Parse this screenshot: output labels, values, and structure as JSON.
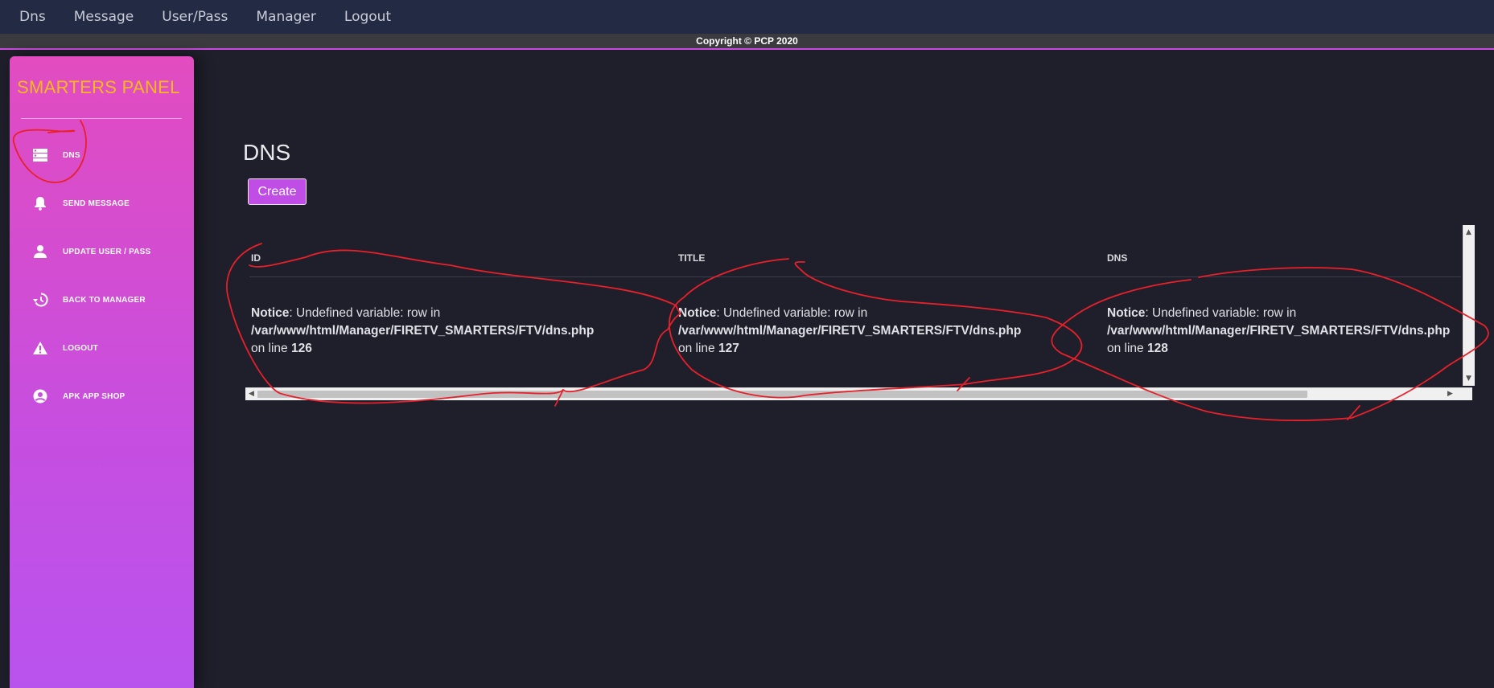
{
  "topnav": {
    "items": [
      "Dns",
      "Message",
      "User/Pass",
      "Manager",
      "Logout"
    ]
  },
  "copyright": "Copyright © PCP 2020",
  "sidebar": {
    "brand": "SMARTERS PANEL",
    "items": [
      {
        "label": "DNS",
        "icon": "dns-server-icon"
      },
      {
        "label": "SEND MESSAGE",
        "icon": "bell-icon"
      },
      {
        "label": "UPDATE USER / PASS",
        "icon": "person-icon"
      },
      {
        "label": "BACK TO MANAGER",
        "icon": "history-icon"
      },
      {
        "label": "LOGOUT",
        "icon": "warning-icon"
      },
      {
        "label": "APK APP SHOP",
        "icon": "account-circle-icon"
      }
    ]
  },
  "main": {
    "title": "DNS",
    "create_label": "Create",
    "table": {
      "columns": [
        "ID",
        "TITLE",
        "DNS"
      ],
      "row": [
        {
          "notice": "Notice",
          "message": ": Undefined variable: row in",
          "path": "/var/www/html/Manager/FIRETV_SMARTERS/FTV/dns.php",
          "line_prefix": "on line ",
          "line": "126"
        },
        {
          "notice": "Notice",
          "message": ": Undefined variable: row in",
          "path": "/var/www/html/Manager/FIRETV_SMARTERS/FTV/dns.php",
          "line_prefix": "on line ",
          "line": "127"
        },
        {
          "notice": "Notice",
          "message": ": Undefined variable: row in",
          "path": "/var/www/html/Manager/FIRETV_SMARTERS/FTV/dns.php",
          "line_prefix": "on line ",
          "line": "128"
        }
      ]
    }
  },
  "colors": {
    "topnav_bg": "#232b44",
    "page_bg": "#1f1f2b",
    "brand": "#f7b91d",
    "accent": "#c04de6",
    "annotation": "#e8202a"
  }
}
